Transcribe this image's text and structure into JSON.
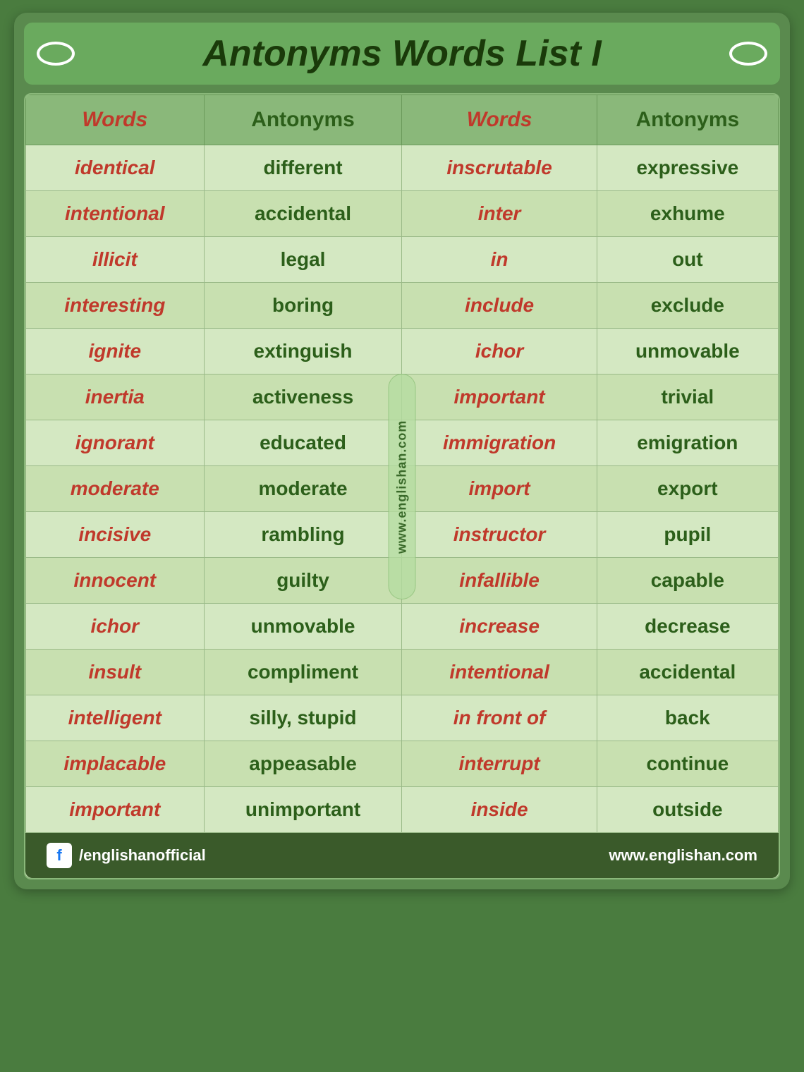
{
  "header": {
    "title": "Antonyms Words  List I"
  },
  "table": {
    "columns": [
      {
        "label": "Words",
        "type": "word"
      },
      {
        "label": "Antonyms",
        "type": "antonym"
      },
      {
        "label": "Words",
        "type": "word"
      },
      {
        "label": "Antonyms",
        "type": "antonym"
      }
    ],
    "rows": [
      {
        "w1": "identical",
        "a1": "different",
        "w2": "inscrutable",
        "a2": "expressive"
      },
      {
        "w1": "intentional",
        "a1": "accidental",
        "w2": "inter",
        "a2": "exhume"
      },
      {
        "w1": "illicit",
        "a1": "legal",
        "w2": "in",
        "a2": "out"
      },
      {
        "w1": "interesting",
        "a1": "boring",
        "w2": "include",
        "a2": "exclude"
      },
      {
        "w1": "ignite",
        "a1": "extinguish",
        "w2": "ichor",
        "a2": "unmovable"
      },
      {
        "w1": "inertia",
        "a1": "activeness",
        "w2": "important",
        "a2": "trivial"
      },
      {
        "w1": "ignorant",
        "a1": "educated",
        "w2": "immigration",
        "a2": "emigration"
      },
      {
        "w1": "moderate",
        "a1": "moderate",
        "w2": "import",
        "a2": "export"
      },
      {
        "w1": "incisive",
        "a1": "rambling",
        "w2": "instructor",
        "a2": "pupil"
      },
      {
        "w1": "innocent",
        "a1": "guilty",
        "w2": "infallible",
        "a2": "capable"
      },
      {
        "w1": "ichor",
        "a1": "unmovable",
        "w2": "increase",
        "a2": "decrease"
      },
      {
        "w1": "insult",
        "a1": "compliment",
        "w2": "intentional",
        "a2": "accidental"
      },
      {
        "w1": "intelligent",
        "a1": "silly, stupid",
        "w2": "in front of",
        "a2": "back"
      },
      {
        "w1": "implacable",
        "a1": "appeasable",
        "w2": "interrupt",
        "a2": "continue"
      },
      {
        "w1": "important",
        "a1": "unimportant",
        "w2": "inside",
        "a2": "outside"
      }
    ]
  },
  "watermark": {
    "text": "www.englishan.com"
  },
  "footer": {
    "fb_handle": "/englishanofficial",
    "website": "www.englishan.com"
  }
}
